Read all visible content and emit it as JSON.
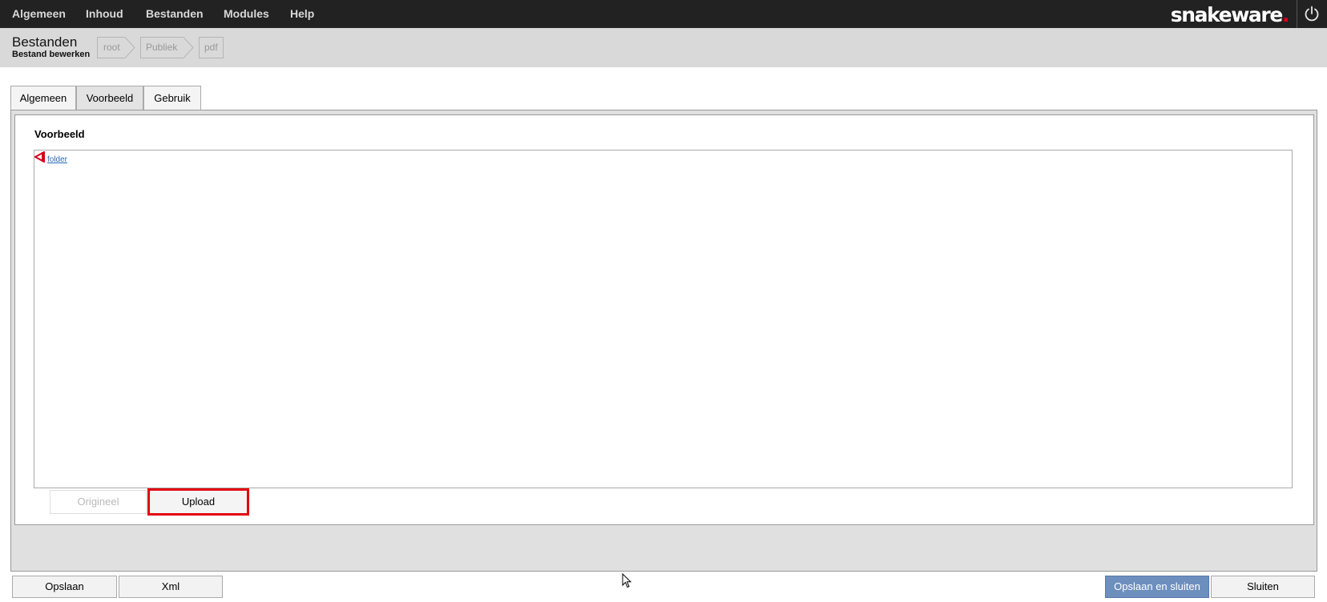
{
  "topnav": {
    "items": [
      "Algemeen",
      "Inhoud",
      "Bestanden",
      "Modules",
      "Help"
    ],
    "logo_text": "snakeware",
    "logo_dot": ".",
    "power_icon": "power-icon"
  },
  "header": {
    "title": "Bestanden",
    "subtitle": "Bestand bewerken",
    "breadcrumb": [
      "root",
      "Publiek",
      "pdf"
    ]
  },
  "tabs": [
    {
      "label": "Algemeen",
      "active": false
    },
    {
      "label": "Voorbeeld",
      "active": true
    },
    {
      "label": "Gebruik",
      "active": false
    }
  ],
  "preview": {
    "title": "Voorbeeld",
    "file_icon": "pdf-icon",
    "link_text": "folder"
  },
  "preview_actions": {
    "origineel": "Origineel",
    "upload": "Upload"
  },
  "footer": {
    "opslaan": "Opslaan",
    "xml": "Xml",
    "opslaan_sluiten": "Opslaan en sluiten",
    "sluiten": "Sluiten"
  },
  "colors": {
    "topbar": "#222222",
    "accent_red": "#e2001a",
    "primary_button": "#6d8fbe",
    "link": "#2d6bb5"
  }
}
